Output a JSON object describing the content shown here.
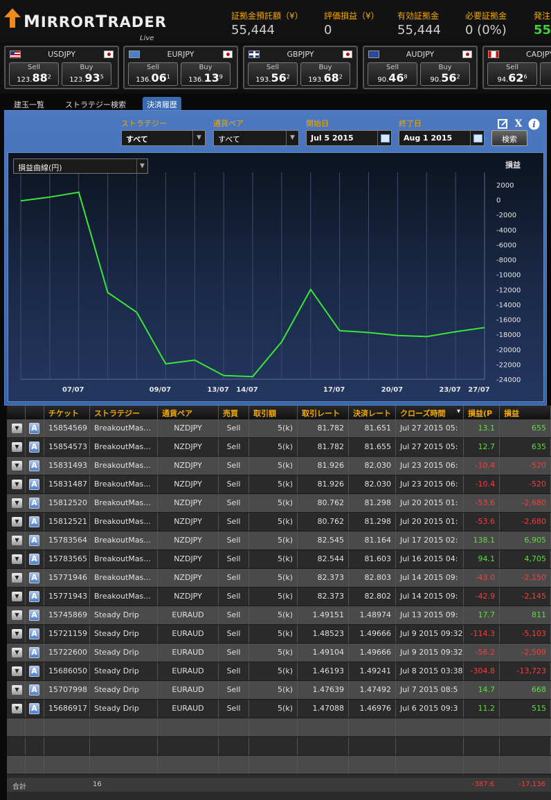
{
  "brand": {
    "name": "MirrorTrader",
    "sub": "Live"
  },
  "header": {
    "stats": [
      {
        "label": "証拠金預託額（¥）",
        "value": "55,444",
        "color": "#cfcfcf"
      },
      {
        "label": "評価損益（¥）",
        "value": "0",
        "color": "#cfcfcf"
      },
      {
        "label": "有効証拠金",
        "value": "55,444",
        "color": "#cfcfcf"
      },
      {
        "label": "必要証拠金",
        "value": "0 (0%)",
        "color": "#cfcfcf"
      },
      {
        "label": "発注",
        "value": "55,",
        "color": "#39d43a"
      }
    ]
  },
  "quotes": [
    {
      "symbol": "USDJPY",
      "flag": "flag-us-icon",
      "sell": {
        "label": "Sell",
        "pre": "123.",
        "big": "88",
        "sup": "2"
      },
      "buy": {
        "label": "Buy",
        "pre": "123.",
        "big": "93",
        "sup": "5"
      }
    },
    {
      "symbol": "EURJPY",
      "flag": "flag-eu-icon",
      "sell": {
        "label": "Sell",
        "pre": "136.",
        "big": "06",
        "sup": "1"
      },
      "buy": {
        "label": "Buy",
        "pre": "136.",
        "big": "13",
        "sup": "9"
      }
    },
    {
      "symbol": "GBPJPY",
      "flag": "flag-gb-icon",
      "sell": {
        "label": "Sell",
        "pre": "193.",
        "big": "56",
        "sup": "2"
      },
      "buy": {
        "label": "Buy",
        "pre": "193.",
        "big": "68",
        "sup": "2"
      }
    },
    {
      "symbol": "AUDJPY",
      "flag": "flag-au-icon",
      "sell": {
        "label": "Sell",
        "pre": "90.",
        "big": "46",
        "sup": "8"
      },
      "buy": {
        "label": "Buy",
        "pre": "90.",
        "big": "56",
        "sup": "2"
      }
    },
    {
      "symbol": "CADJPY",
      "flag": "flag-ca-icon",
      "sell": {
        "label": "Sell",
        "pre": "94.",
        "big": "62",
        "sup": "6"
      },
      "buy": {
        "label": "Buy",
        "pre": "",
        "big": "",
        "sup": ""
      }
    }
  ],
  "tabs": [
    {
      "label": "建玉一覧",
      "active": false
    },
    {
      "label": "ストラテジー検索",
      "active": false
    },
    {
      "label": "決済履歴",
      "active": true
    }
  ],
  "filters": {
    "strategy": {
      "label": "ストラテジー",
      "value": "すべて"
    },
    "pair": {
      "label": "通貨ペア",
      "value": "すべて"
    },
    "start": {
      "label": "開始日",
      "value": "Jul 5 2015"
    },
    "end": {
      "label": "終了日",
      "value": "Aug 1 2015"
    },
    "search_label": "検索"
  },
  "chart_data": {
    "type": "line",
    "selector": "損益曲線(円)",
    "ylabel": "損益",
    "ylim": [
      -24000,
      2000
    ],
    "yticks": [
      2000,
      0,
      -2000,
      -4000,
      -6000,
      -8000,
      -10000,
      -12000,
      -14000,
      -16000,
      -18000,
      -20000,
      -22000,
      -24000
    ],
    "xticks": [
      "07/07",
      "09/07",
      "13/07",
      "14/07",
      "17/07",
      "20/07",
      "23/07",
      "27/07"
    ],
    "x_index_range": [
      0,
      16
    ],
    "series": [
      {
        "color": "#39e639",
        "x": [
          0,
          1,
          2,
          3,
          4,
          5,
          6,
          7,
          8,
          9,
          10,
          11,
          12,
          13,
          14,
          15,
          16
        ],
        "values": [
          -150,
          350,
          1000,
          -12400,
          -15050,
          -21950,
          -21450,
          -23500,
          -23650,
          -19000,
          -12000,
          -17500,
          -17750,
          -18150,
          -18300,
          -17650,
          -17100
        ]
      }
    ]
  },
  "table": {
    "headers": [
      "",
      "",
      "チケット",
      "ストラテジー",
      "通貨ペア",
      "売買",
      "取引額",
      "取引レート",
      "決済レート",
      "クローズ時間",
      "損益(P",
      "損益"
    ],
    "rows": [
      {
        "ticket": "15854569",
        "strategy": "BreakoutMas...",
        "pair": "NZDJPY",
        "side": "Sell",
        "amount": "5(k)",
        "rate": "81.782",
        "close_rate": "81.651",
        "close_time": "Jul 27 2015 05:",
        "pips": "13.1",
        "pl": "655",
        "sign": "pos"
      },
      {
        "ticket": "15854573",
        "strategy": "BreakoutMas...",
        "pair": "NZDJPY",
        "side": "Sell",
        "amount": "5(k)",
        "rate": "81.782",
        "close_rate": "81.655",
        "close_time": "Jul 27 2015 05:",
        "pips": "12.7",
        "pl": "635",
        "sign": "pos"
      },
      {
        "ticket": "15831493",
        "strategy": "BreakoutMas...",
        "pair": "NZDJPY",
        "side": "Sell",
        "amount": "5(k)",
        "rate": "81.926",
        "close_rate": "82.030",
        "close_time": "Jul 23 2015 06:",
        "pips": "-10.4",
        "pl": "-520",
        "sign": "neg"
      },
      {
        "ticket": "15831487",
        "strategy": "BreakoutMas...",
        "pair": "NZDJPY",
        "side": "Sell",
        "amount": "5(k)",
        "rate": "81.926",
        "close_rate": "82.030",
        "close_time": "Jul 23 2015 06:",
        "pips": "-10.4",
        "pl": "-520",
        "sign": "neg"
      },
      {
        "ticket": "15812520",
        "strategy": "BreakoutMas...",
        "pair": "NZDJPY",
        "side": "Sell",
        "amount": "5(k)",
        "rate": "80.762",
        "close_rate": "81.298",
        "close_time": "Jul 20 2015 01:",
        "pips": "-53.6",
        "pl": "-2,680",
        "sign": "neg"
      },
      {
        "ticket": "15812521",
        "strategy": "BreakoutMas...",
        "pair": "NZDJPY",
        "side": "Sell",
        "amount": "5(k)",
        "rate": "80.762",
        "close_rate": "81.298",
        "close_time": "Jul 20 2015 01:",
        "pips": "-53.6",
        "pl": "-2,680",
        "sign": "neg"
      },
      {
        "ticket": "15783564",
        "strategy": "BreakoutMas...",
        "pair": "NZDJPY",
        "side": "Sell",
        "amount": "5(k)",
        "rate": "82.545",
        "close_rate": "81.164",
        "close_time": "Jul 17 2015 02:",
        "pips": "138.1",
        "pl": "6,905",
        "sign": "pos"
      },
      {
        "ticket": "15783565",
        "strategy": "BreakoutMas...",
        "pair": "NZDJPY",
        "side": "Sell",
        "amount": "5(k)",
        "rate": "82.544",
        "close_rate": "81.603",
        "close_time": "Jul 16 2015 04:",
        "pips": "94.1",
        "pl": "4,705",
        "sign": "pos"
      },
      {
        "ticket": "15771946",
        "strategy": "BreakoutMas...",
        "pair": "NZDJPY",
        "side": "Sell",
        "amount": "5(k)",
        "rate": "82.373",
        "close_rate": "82.803",
        "close_time": "Jul 14 2015 09:",
        "pips": "-43.0",
        "pl": "-2,150",
        "sign": "neg"
      },
      {
        "ticket": "15771943",
        "strategy": "BreakoutMas...",
        "pair": "NZDJPY",
        "side": "Sell",
        "amount": "5(k)",
        "rate": "82.373",
        "close_rate": "82.802",
        "close_time": "Jul 14 2015 09:",
        "pips": "-42.9",
        "pl": "-2,145",
        "sign": "neg"
      },
      {
        "ticket": "15745869",
        "strategy": "Steady Drip",
        "pair": "EURAUD",
        "side": "Sell",
        "amount": "5(k)",
        "rate": "1.49151",
        "close_rate": "1.48974",
        "close_time": "Jul 13 2015 09:",
        "pips": "17.7",
        "pl": "811",
        "sign": "pos"
      },
      {
        "ticket": "15721159",
        "strategy": "Steady Drip",
        "pair": "EURAUD",
        "side": "Sell",
        "amount": "5(k)",
        "rate": "1.48523",
        "close_rate": "1.49666",
        "close_time": "Jul 9 2015 09:32",
        "pips": "-114.3",
        "pl": "-5,103",
        "sign": "neg"
      },
      {
        "ticket": "15722600",
        "strategy": "Steady Drip",
        "pair": "EURAUD",
        "side": "Sell",
        "amount": "5(k)",
        "rate": "1.49104",
        "close_rate": "1.49666",
        "close_time": "Jul 9 2015 09:32",
        "pips": "-56.2",
        "pl": "-2,509",
        "sign": "neg"
      },
      {
        "ticket": "15686050",
        "strategy": "Steady Drip",
        "pair": "EURAUD",
        "side": "Sell",
        "amount": "5(k)",
        "rate": "1.46193",
        "close_rate": "1.49241",
        "close_time": "Jul 8 2015 03:38",
        "pips": "-304.8",
        "pl": "-13,723",
        "sign": "neg"
      },
      {
        "ticket": "15707998",
        "strategy": "Steady Drip",
        "pair": "EURAUD",
        "side": "Sell",
        "amount": "5(k)",
        "rate": "1.47639",
        "close_rate": "1.47492",
        "close_time": "Jul 7 2015 08:5",
        "pips": "14.7",
        "pl": "668",
        "sign": "pos"
      },
      {
        "ticket": "15686917",
        "strategy": "Steady Drip",
        "pair": "EURAUD",
        "side": "Sell",
        "amount": "5(k)",
        "rate": "1.47088",
        "close_rate": "1.46976",
        "close_time": "Jul 6 2015 09:3",
        "pips": "11.2",
        "pl": "515",
        "sign": "pos"
      }
    ],
    "total": {
      "label": "合計",
      "count": "16",
      "pips": "-387.6",
      "pl": "-17,136"
    }
  }
}
